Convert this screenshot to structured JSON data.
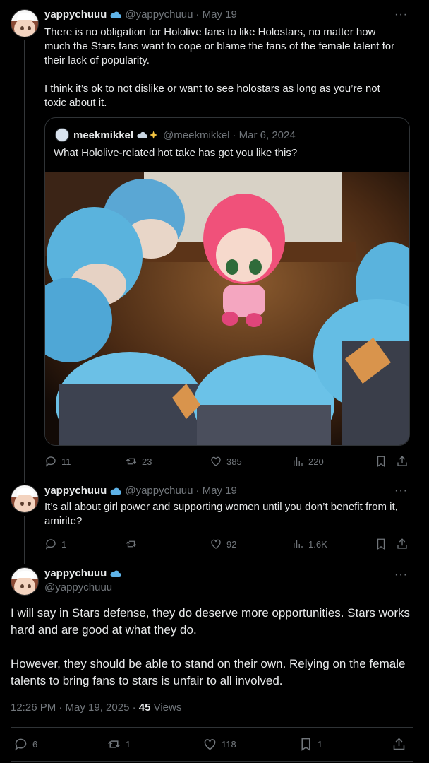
{
  "tweets": [
    {
      "name": "yappychuuu",
      "handle": "@yappychuuu",
      "date": "· May 19",
      "more": "···",
      "text": "There is no obligation for Hololive fans to like Holostars, no matter how much the Stars fans want to cope or blame the fans of the female talent for their lack of popularity.\n\nI think it’s ok to not dislike or want to see holostars as long as you’re not toxic about it.",
      "quote": {
        "name": "meekmikkel",
        "handle": "@meekmikkel",
        "date": "· Mar 6, 2024",
        "text": "What Hololive-related hot take has got you like this?"
      },
      "replies": "11",
      "reposts": "23",
      "likes": "385",
      "views": "220"
    },
    {
      "name": "yappychuuu",
      "handle": "@yappychuuu",
      "date": "· May 19",
      "more": "···",
      "text": "It’s all about girl power and supporting women until you don’t benefit from it, amirite?",
      "replies": "1",
      "reposts": "",
      "likes": "92",
      "views": "1.6K"
    }
  ],
  "main": {
    "name": "yappychuuu",
    "handle": "@yappychuuu",
    "more": "···",
    "text": "I will say in Stars defense, they do deserve more opportunities. Stars works hard and are good at what they do.\n\nHowever, they should be able to stand on their own. Relying on the female talents to bring fans to stars is unfair to all involved.",
    "timestamp": "12:26 PM · May 19, 2025 · ",
    "views_count": "45",
    "views_label": " Views",
    "replies": "6",
    "reposts": "1",
    "likes": "118",
    "bookmarks": "1"
  },
  "colors": {
    "background": "#000000",
    "text": "#e7e9ea",
    "muted": "#71767b",
    "border": "#2f3336",
    "verified": "#1d9bf0"
  }
}
